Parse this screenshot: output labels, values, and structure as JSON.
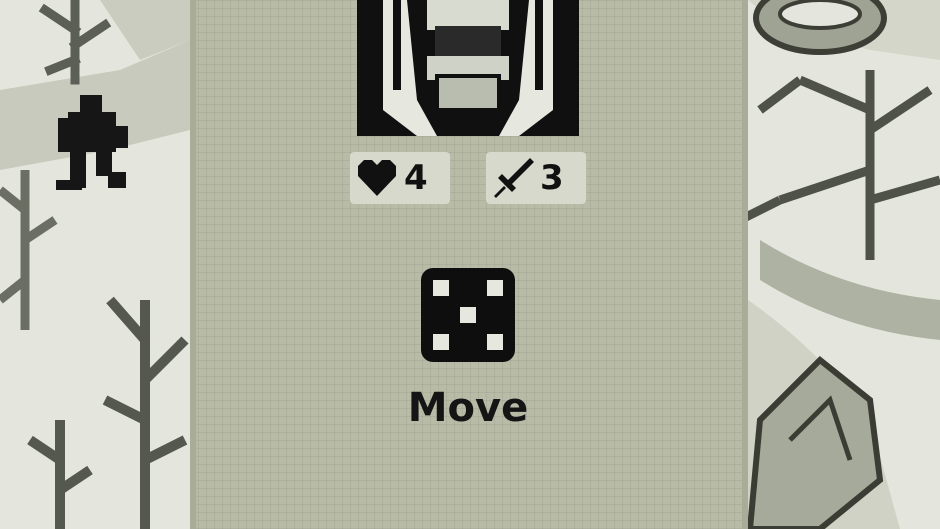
{
  "player": {
    "health_value": "4",
    "attack_value": "3"
  },
  "action": {
    "label": "Move",
    "dice_face": 5
  },
  "icons": {
    "health": "heart-icon",
    "attack": "sword-icon",
    "action": "dice-icon"
  },
  "palette": {
    "panel": "#b8bca7",
    "snow": "#e4e6dd",
    "ink": "#111111",
    "tree": "#5c5f55"
  }
}
